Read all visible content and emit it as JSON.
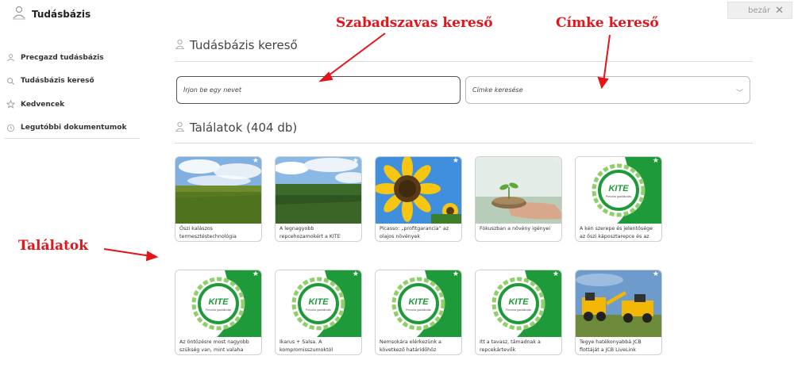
{
  "app": {
    "title": "Tudásbázis"
  },
  "close": {
    "label": "bezár",
    "icon": "close-icon"
  },
  "sidebar": {
    "items": [
      {
        "label": "Precgazd tudásbázis",
        "icon": "person-icon"
      },
      {
        "label": "Tudásbázis kereső",
        "icon": "search-icon"
      },
      {
        "label": "Kedvencek",
        "icon": "star-icon"
      },
      {
        "label": "Legutóbbi dokumentumok",
        "icon": "clock-icon"
      }
    ]
  },
  "search": {
    "heading": "Tudásbázis kereső",
    "free_placeholder": "Írjon be egy nevet",
    "tag_placeholder": "Címke keresése"
  },
  "results": {
    "heading": "Találatok (404 db)",
    "cards": [
      {
        "caption": "Őszi kalászos termesztéstechnológia",
        "image": "wheat-field",
        "favorite": false
      },
      {
        "caption": "A legnagyobb repcehozamokért a KITE",
        "image": "rapeseed-field",
        "favorite": false
      },
      {
        "caption": "Picasso: „profitgarancia” az olajos növények",
        "image": "sunflower",
        "favorite": false
      },
      {
        "caption": "Fókuszban a növény igényei",
        "image": "soil-hand",
        "favorite": false
      },
      {
        "caption": "A kén szerepe és jelentősége az őszi káposztarepce és az",
        "image": "kite-logo",
        "favorite": false
      },
      {
        "caption": "Az öntözésre most nagyobb szükség van, mint valaha",
        "image": "kite-logo",
        "favorite": false
      },
      {
        "caption": "Ikarus + Salsa. A kompromisszumoktól",
        "image": "kite-logo",
        "favorite": false
      },
      {
        "caption": "Nemsokára elérkezünk a következő határidőhöz",
        "image": "kite-logo",
        "favorite": false
      },
      {
        "caption": "Itt a tavasz, támadnak a repcekártevők",
        "image": "kite-logo",
        "favorite": false
      },
      {
        "caption": "Tegye hatékonyabbá JCB flottáját a JCB LiveLink",
        "image": "jcb-machines",
        "favorite": false
      }
    ]
  },
  "annotations": {
    "free_search": "Szabadszavas kereső",
    "tag_search": "Címke kereső",
    "results": "Találatok"
  },
  "logo_text": {
    "kite": "KITE",
    "sub": "Precíziós gazdálkodás"
  },
  "colors": {
    "annotation": "#e3141a",
    "kite_green": "#1f9a3a"
  }
}
